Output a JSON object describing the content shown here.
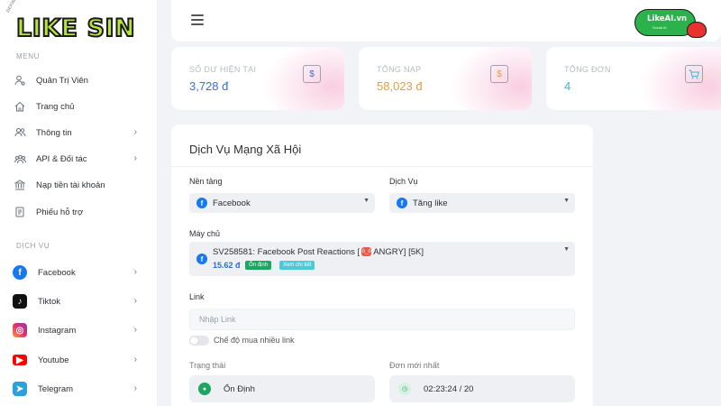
{
  "logo": {
    "text": "LIKE SIN",
    "tagline": "DEFINE YOUR OWN IDENTITY"
  },
  "brand_badge": {
    "text": "LikeAI.vn",
    "sub": "Social AI"
  },
  "menu": {
    "title": "MENU",
    "items": [
      {
        "label": "Quản Trị Viên",
        "icon": "user-admin-icon"
      },
      {
        "label": "Trang chủ",
        "icon": "home-icon"
      },
      {
        "label": "Thông tin",
        "icon": "users-icon",
        "chevron": true
      },
      {
        "label": "API & Đối tác",
        "icon": "api-icon",
        "chevron": true
      },
      {
        "label": "Nạp tiền tài khoản",
        "icon": "bank-icon"
      },
      {
        "label": "Phiếu hỗ trợ",
        "icon": "ticket-icon"
      }
    ]
  },
  "services_menu": {
    "title": "DỊCH VỤ",
    "items": [
      {
        "label": "Facebook",
        "icon": "facebook-icon",
        "color": "#1877f2"
      },
      {
        "label": "Tiktok",
        "icon": "tiktok-icon",
        "color": "#111111"
      },
      {
        "label": "Instagram",
        "icon": "instagram-icon",
        "color": "#e1306c"
      },
      {
        "label": "Youtube",
        "icon": "youtube-icon",
        "color": "#ff0000"
      },
      {
        "label": "Telegram",
        "icon": "telegram-icon",
        "color": "#2aa1da"
      }
    ]
  },
  "stats": [
    {
      "label": "SỐ DƯ HIỆN TẠI",
      "value": "3,728 đ",
      "color": "#3a6fd8",
      "icon": "dollar-icon"
    },
    {
      "label": "TỔNG NẠP",
      "value": "58,023 đ",
      "color": "#e0a03c",
      "icon": "dollar-icon"
    },
    {
      "label": "TỔNG ĐƠN",
      "value": "4",
      "color": "#45b3c9",
      "icon": "cart-icon"
    }
  ],
  "form": {
    "title": "Dịch Vụ Mạng Xã Hội",
    "platform_label": "Nền tảng",
    "platform_value": "Facebook",
    "service_label": "Dịch Vụ",
    "service_value": "Tăng like",
    "server_label": "Máy chủ",
    "server_name_prefix": "SV258581: Facebook Post Reactions [",
    "server_name_suffix": "ANGRY] [5K]",
    "server_price": "15.62 đ",
    "server_tag_stable": "Ổn định",
    "server_tag_detail": "Xem chi tiết",
    "link_label": "Link",
    "link_placeholder": "Nhập Link",
    "multi_link_label": "Chế độ mua nhiều link",
    "status_label": "Trạng thái",
    "status_value": "Ổn Định",
    "latest_order_label": "Đơn mới nhất",
    "latest_order_value": "02:23:24 / 20"
  }
}
